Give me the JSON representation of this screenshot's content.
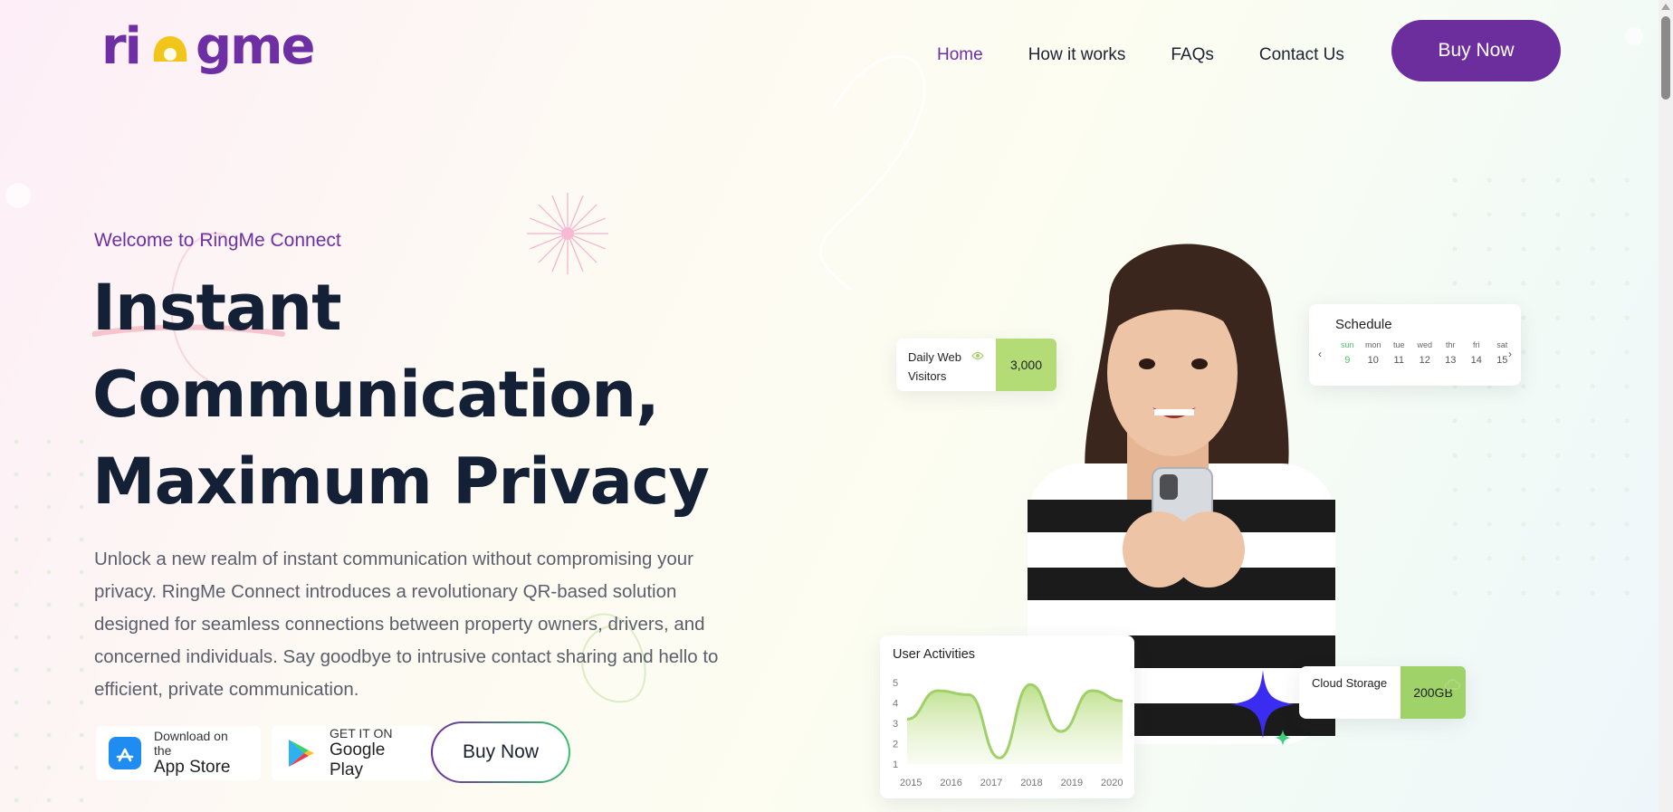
{
  "brand": {
    "logo_text_a": "ri",
    "logo_text_b": "gme"
  },
  "nav": {
    "items": [
      {
        "label": "Home",
        "active": true
      },
      {
        "label": "How it works",
        "active": false
      },
      {
        "label": "FAQs",
        "active": false
      },
      {
        "label": "Contact Us",
        "active": false
      }
    ],
    "buy_label": "Buy Now"
  },
  "hero": {
    "welcome": "Welcome to RingMe Connect",
    "headline": [
      "Instant",
      "Communication,",
      "Maximum Privacy"
    ],
    "description": "Unlock a new realm of instant communication without compromising your privacy. RingMe Connect introduces a revolutionary QR-based solution designed for seamless connections between property owners, drivers, and concerned individuals. Say goodbye to intrusive contact sharing and hello to efficient, private communication.",
    "appstore": {
      "small": "Download on the",
      "big": "App Store"
    },
    "googleplay": {
      "small": "GET IT ON",
      "big": "Google Play"
    },
    "buy_label": "Buy Now"
  },
  "widgets": {
    "visitors": {
      "label": "Daily Web Visitors",
      "value": "3,000"
    },
    "schedule": {
      "title": "Schedule",
      "days": [
        "sun",
        "mon",
        "tue",
        "wed",
        "thr",
        "fri",
        "sat"
      ],
      "dates": [
        "9",
        "10",
        "11",
        "12",
        "13",
        "14",
        "15"
      ],
      "highlight_index": 0
    },
    "activities": {
      "title": "User Activities",
      "chart_data": {
        "type": "area",
        "title": "User Activities",
        "x": [
          "2015",
          "2016",
          "2017",
          "2018",
          "2019",
          "2020"
        ],
        "y_ticks": [
          1,
          2,
          3,
          4,
          5
        ],
        "ylim": [
          1,
          5
        ],
        "values": [
          3.2,
          4.6,
          4.4,
          1.3,
          4.9,
          2.6,
          4.6,
          4.1
        ]
      }
    },
    "storage": {
      "label": "Cloud Storage",
      "value": "200GB"
    }
  },
  "colors": {
    "brand_purple": "#6c2e9c",
    "logo_yellow": "#f2c51b",
    "accent_green": "#b3db76",
    "heading": "#142036"
  }
}
